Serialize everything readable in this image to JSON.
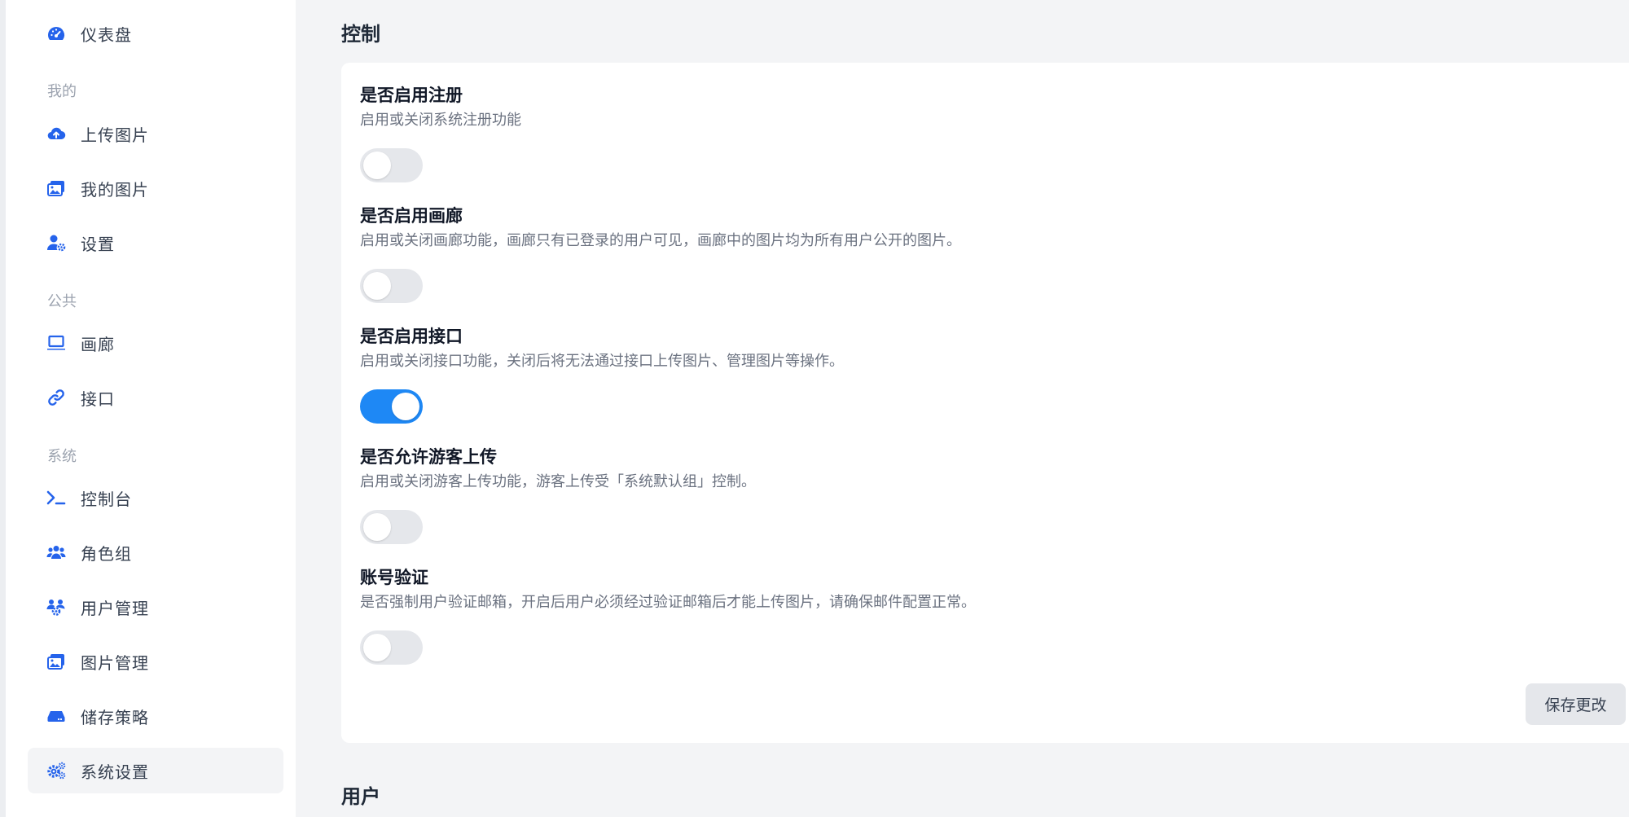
{
  "sidebar": {
    "accent_color": "#2563eb",
    "items": [
      {
        "label": "仪表盘",
        "icon": "dashboard-icon"
      },
      {
        "label": "上传图片",
        "icon": "cloud-upload-icon"
      },
      {
        "label": "我的图片",
        "icon": "images-icon"
      },
      {
        "label": "设置",
        "icon": "user-settings-icon"
      },
      {
        "label": "画廊",
        "icon": "laptop-icon"
      },
      {
        "label": "接口",
        "icon": "link-icon"
      },
      {
        "label": "控制台",
        "icon": "terminal-icon"
      },
      {
        "label": "角色组",
        "icon": "users-icon"
      },
      {
        "label": "用户管理",
        "icon": "users-gear-icon"
      },
      {
        "label": "图片管理",
        "icon": "images-icon"
      },
      {
        "label": "储存策略",
        "icon": "drive-icon"
      },
      {
        "label": "系统设置",
        "icon": "gears-icon",
        "active": true
      }
    ],
    "groups": {
      "mine": "我的",
      "public": "公共",
      "system": "系统"
    }
  },
  "main": {
    "section_control": "控制",
    "section_user": "用户",
    "settings": [
      {
        "title": "是否启用注册",
        "desc": "启用或关闭系统注册功能",
        "enabled": false
      },
      {
        "title": "是否启用画廊",
        "desc": "启用或关闭画廊功能，画廊只有已登录的用户可见，画廊中的图片均为所有用户公开的图片。",
        "enabled": false
      },
      {
        "title": "是否启用接口",
        "desc": "启用或关闭接口功能，关闭后将无法通过接口上传图片、管理图片等操作。",
        "enabled": true
      },
      {
        "title": "是否允许游客上传",
        "desc": "启用或关闭游客上传功能，游客上传受「系统默认组」控制。",
        "enabled": false
      },
      {
        "title": "账号验证",
        "desc": "是否强制用户验证邮箱，开启后用户必须经过验证邮箱后才能上传图片，请确保邮件配置正常。",
        "enabled": false
      }
    ],
    "save_label": "保存更改",
    "toggle_on_color": "#1e88f5",
    "toggle_off_color": "#e5e7eb"
  }
}
